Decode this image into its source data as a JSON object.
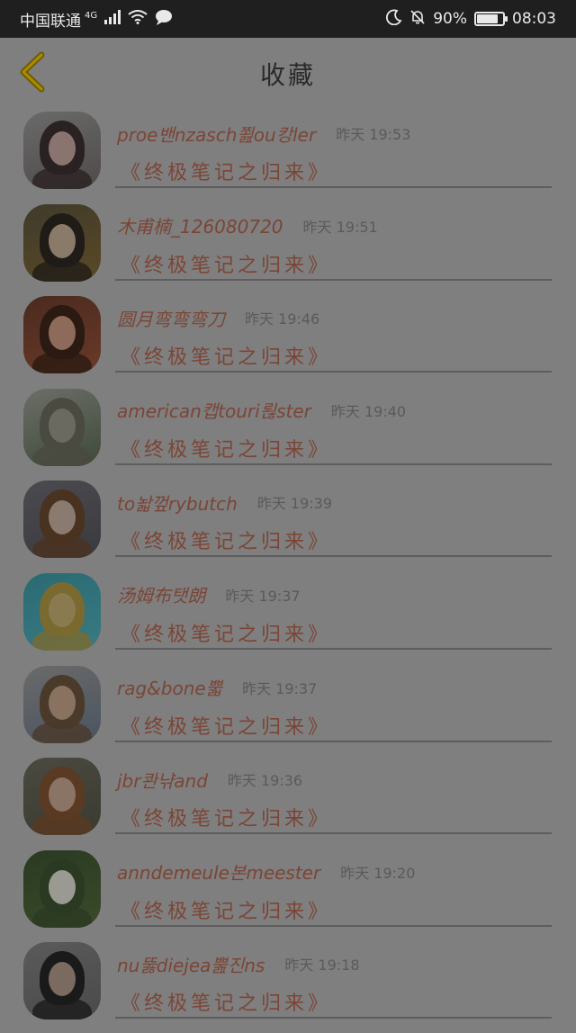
{
  "status_bar": {
    "carrier": "中国联通",
    "network": "4G",
    "battery": "90%",
    "battery_level": 0.9,
    "time": "08:03",
    "icons": [
      "signal-icon",
      "wifi-icon",
      "chat-icon",
      "moon-icon",
      "mute-bell-icon",
      "battery-icon"
    ]
  },
  "header": {
    "title": "收藏",
    "back_icon": "chevron-left-icon"
  },
  "items": [
    {
      "name": "proe밴nzasch쬞ou캉ler",
      "time": "昨天 19:53",
      "book": "《终极笔记之归来》"
    },
    {
      "name": "木甫楠_126080720",
      "time": "昨天 19:51",
      "book": "《终极笔记之归来》"
    },
    {
      "name": "圆月弯弯弯刀",
      "time": "昨天 19:46",
      "book": "《终极笔记之归来》"
    },
    {
      "name": "american캡touri뢶ster",
      "time": "昨天 19:40",
      "book": "《终极笔记之归来》"
    },
    {
      "name": "to놟껖rybutch",
      "time": "昨天 19:39",
      "book": "《终极笔记之归来》"
    },
    {
      "name": "汤姆布탯朗",
      "time": "昨天 19:37",
      "book": "《终极笔记之归来》"
    },
    {
      "name": "rag&bone뿗",
      "time": "昨天 19:37",
      "book": "《终极笔记之归来》"
    },
    {
      "name": "jbr콴냒and",
      "time": "昨天 19:36",
      "book": "《终极笔记之归来》"
    },
    {
      "name": "anndemeule본meester",
      "time": "昨天 19:20",
      "book": "《终极笔记之归来》"
    },
    {
      "name": "nu뚫diejea뿚진ns",
      "time": "昨天 19:18",
      "book": "《终极笔记之归来》"
    }
  ],
  "colors": {
    "overlay": "#7f7f7f",
    "status_bar": "#1f1f1f",
    "name_text": "#7b4536",
    "time_text": "#5a5a5a",
    "back_icon": "#e6b800"
  }
}
